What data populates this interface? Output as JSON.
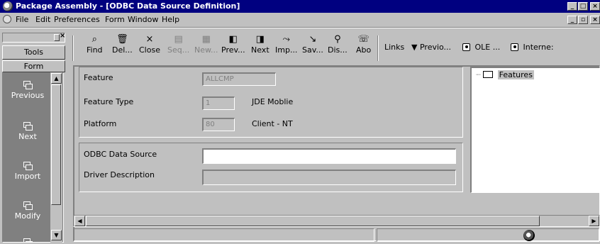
{
  "window": {
    "title": "Package Assembly - [ODBC Data Source Definition]",
    "app_buttons": [
      "_",
      "□",
      "×"
    ],
    "child_buttons": [
      "_",
      "▫",
      "×"
    ]
  },
  "menu": {
    "items": [
      "File",
      "Edit",
      "Preferences",
      "Form",
      "Window",
      "Help"
    ]
  },
  "left_panel": {
    "tabs": [
      "Tools",
      "Form"
    ],
    "actions": [
      "Previous",
      "Next",
      "Import",
      "Modify"
    ]
  },
  "toolbar": {
    "buttons": [
      {
        "label": "Find",
        "icon": "find-icon",
        "enabled": true
      },
      {
        "label": "Del...",
        "icon": "trash-icon",
        "enabled": true
      },
      {
        "label": "Close",
        "icon": "close-icon",
        "enabled": true
      },
      {
        "label": "Seq...",
        "icon": "seq-icon",
        "enabled": false
      },
      {
        "label": "New...",
        "icon": "new-icon",
        "enabled": false
      },
      {
        "label": "Prev...",
        "icon": "prev-icon",
        "enabled": true
      },
      {
        "label": "Next",
        "icon": "next-icon",
        "enabled": true
      },
      {
        "label": "Imp...",
        "icon": "import-icon",
        "enabled": true
      },
      {
        "label": "Sav...",
        "icon": "save-icon",
        "enabled": true
      },
      {
        "label": "Dis...",
        "icon": "display-icon",
        "enabled": true
      },
      {
        "label": "Abo",
        "icon": "about-icon",
        "enabled": true
      }
    ],
    "links_label": "Links",
    "previous_link": "Previo...",
    "ole_link": "OLE ...",
    "internet_link": "Interne:"
  },
  "form": {
    "feature_label": "Feature",
    "feature_value": "ALLCMP",
    "feature_type_label": "Feature Type",
    "feature_type_value": "1",
    "feature_type_desc": "JDE Moblie",
    "platform_label": "Platform",
    "platform_value": "80",
    "platform_desc": "Client - NT",
    "odbc_label": "ODBC Data Source",
    "odbc_value": "",
    "driver_label": "Driver Description",
    "driver_value": ""
  },
  "tree": {
    "root": "Features"
  }
}
